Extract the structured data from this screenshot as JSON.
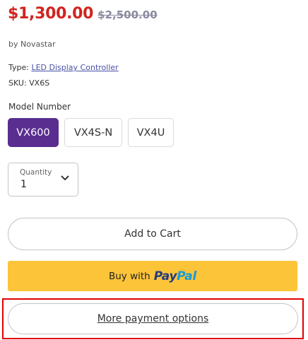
{
  "price": {
    "current": "$1,300.00",
    "compare_at": "$2,500.00",
    "current_color": "#d0241f"
  },
  "vendor": "by Novastar",
  "type_row": {
    "label": "Type: ",
    "value": "LED Display Controller"
  },
  "sku": "SKU: VX6S",
  "model": {
    "label": "Model Number",
    "options": [
      "VX600",
      "VX4S-N",
      "VX4U"
    ],
    "selected": "VX600",
    "selected_color": "#5a2d91"
  },
  "quantity": {
    "label": "Quantity",
    "value": "1",
    "icon": "chevron-down-icon"
  },
  "add_to_cart": "Add to Cart",
  "paypal": {
    "prefix": "Buy with",
    "logo_part1": "Pay",
    "logo_part2": "Pal",
    "button_color": "#fcc439"
  },
  "more_payment_options": "More payment options",
  "highlight_color": "#e00000"
}
